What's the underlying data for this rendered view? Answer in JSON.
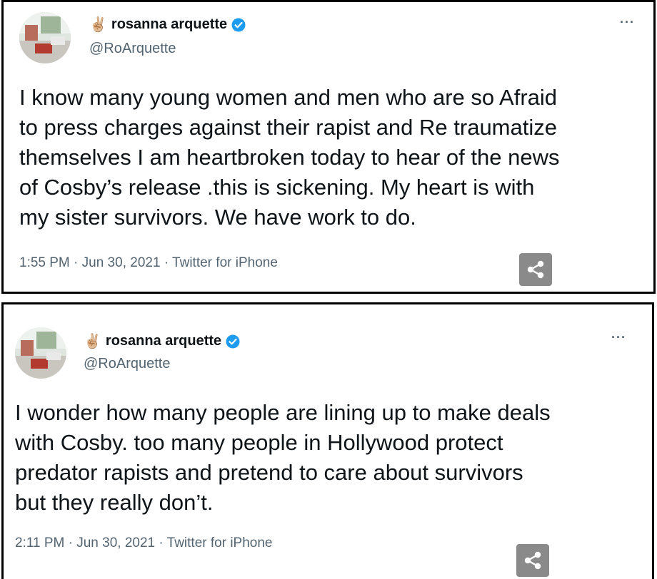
{
  "tweets": [
    {
      "emoji": "✌🏼",
      "display_name": "rosanna arquette",
      "handle": "@RoArquette",
      "more_label": "···",
      "text": "I know many young women and men who are so Afraid\nto press charges against their rapist and Re traumatize\nthemselves I am heartbroken today to hear of the news\nof Cosby’s release  .this is sickening. My heart is with\nmy sister survivors. We have work to do.",
      "meta": "1:55 PM · Jun 30, 2021 · Twitter for iPhone",
      "share_icon": "share-icon"
    },
    {
      "emoji": "✌🏼",
      "display_name": "rosanna arquette",
      "handle": "@RoArquette",
      "more_label": "···",
      "text": "I wonder how many people are lining up to make deals\nwith Cosby. too many people in Hollywood protect\npredator rapists  and pretend to care about survivors\nbut they really don’t.",
      "meta": "2:11 PM · Jun 30, 2021 · Twitter for iPhone",
      "share_icon": "share-icon"
    }
  ],
  "colors": {
    "verified_blue": "#1d9bf0",
    "secondary_text": "#536471",
    "primary_text": "#0f1419",
    "share_button_bg": "#8a8a8a"
  }
}
